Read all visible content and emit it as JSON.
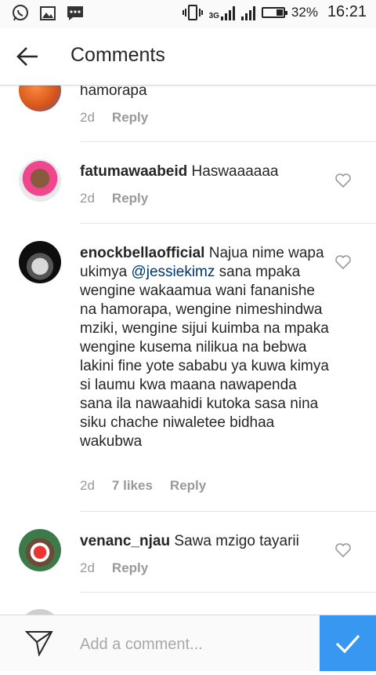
{
  "status_bar": {
    "network": "3G",
    "battery": "32%",
    "battery_level": 0.32,
    "time": "16:21",
    "notification_icons": [
      "whatsapp-icon",
      "gallery-icon",
      "message-icon"
    ]
  },
  "header": {
    "title": "Comments",
    "back_icon": "arrow-left-icon"
  },
  "comments": [
    {
      "username": "",
      "text": "hamorapa",
      "mention": "",
      "text_after": "",
      "time": "2d",
      "likes": "",
      "reply": "Reply"
    },
    {
      "username": "fatumawaabeid",
      "text": "Haswaaaaaa",
      "mention": "",
      "text_after": "",
      "time": "2d",
      "likes": "",
      "reply": "Reply"
    },
    {
      "username": "enockbellaofficial",
      "text": "Najua nime wapa ukimya",
      "mention": "@jessiekimz",
      "text_after": "sana mpaka wengine wakaamua wani fananishe na hamorapa, wengine nimeshindwa mziki, wengine sijui kuimba na mpaka wengine kusema nilikua na bebwa lakini fine yote sababu ya kuwa kimya si laumu kwa maana nawapenda sana ila nawaahidi kutoka sasa nina siku chache niwaletee bidhaa wakubwa",
      "time": "2d",
      "likes": "7 likes",
      "reply": "Reply"
    },
    {
      "username": "venanc_njau",
      "text": "Sawa mzigo tayarii",
      "mention": "",
      "text_after": "",
      "time": "2d",
      "likes": "",
      "reply": "Reply"
    }
  ],
  "composer": {
    "placeholder": "Add a comment...",
    "send_icon": "paper-plane-icon",
    "post_icon": "check-icon"
  },
  "colors": {
    "accent": "#3897f0",
    "mention": "#003569",
    "meta": "#999999"
  }
}
